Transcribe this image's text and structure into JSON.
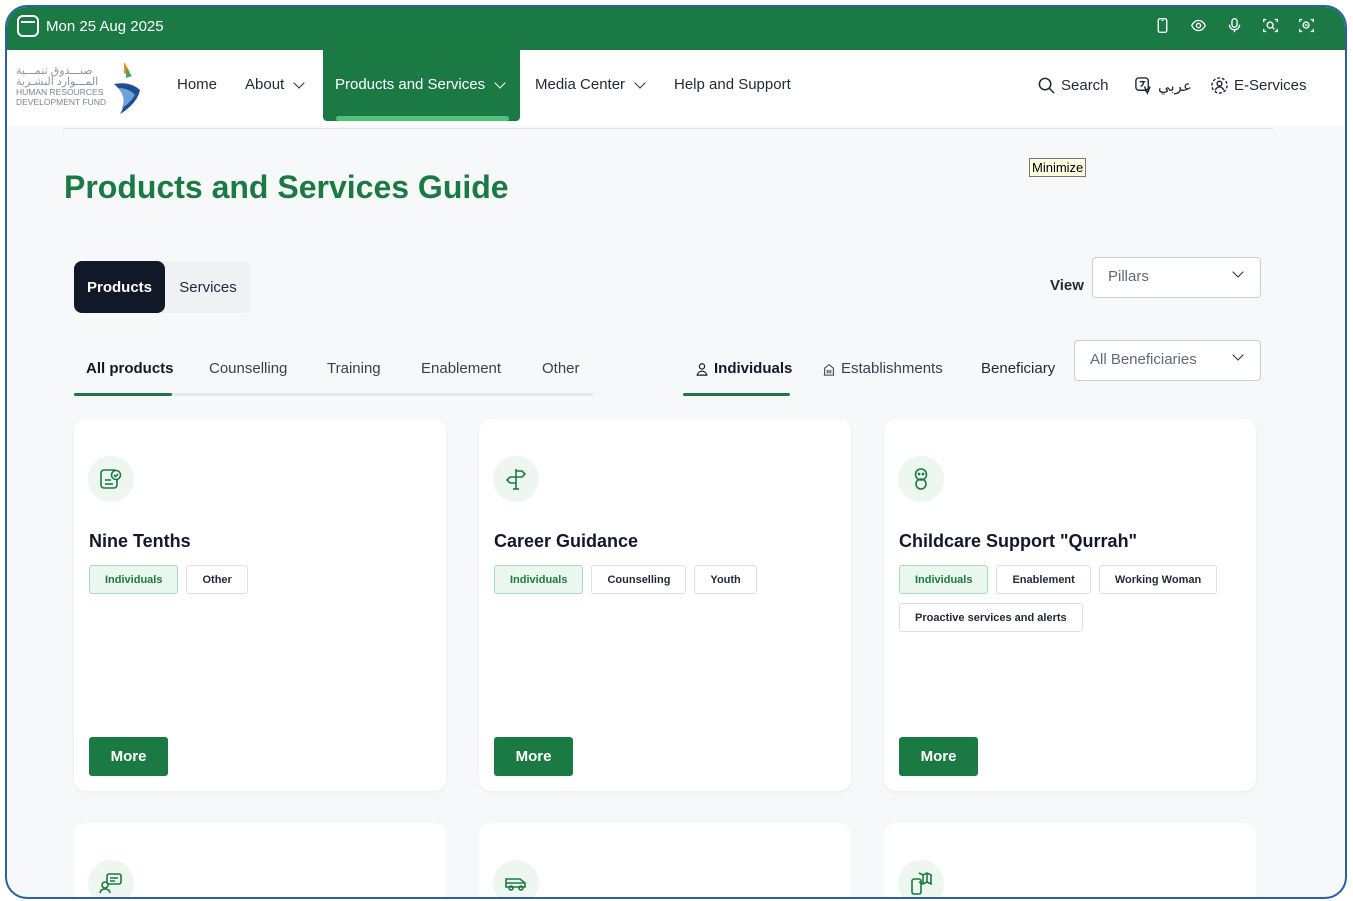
{
  "topbar": {
    "date": "Mon 25 Aug 2025",
    "icons": [
      "phone-icon",
      "eye-icon",
      "microphone-icon",
      "zoom-in-icon",
      "zoom-out-icon"
    ]
  },
  "logo": {
    "arabic_line1": "صنـــدوق تنمـــية",
    "arabic_line2": "المـــوارد البشـرية",
    "english_line1": "HUMAN RESOURCES",
    "english_line2": "DEVELOPMENT FUND"
  },
  "nav": {
    "home": "Home",
    "about": "About",
    "products": "Products and Services",
    "media": "Media Center",
    "help": "Help and Support",
    "search": "Search",
    "language": "عربي",
    "eservices": "E-Services"
  },
  "tooltip": "Minimize",
  "page_title": "Products and Services Guide",
  "segment": {
    "products": "Products",
    "services": "Services"
  },
  "view": {
    "label": "View",
    "selected": "Pillars"
  },
  "category_tabs": [
    "All products",
    "Counselling",
    "Training",
    "Enablement",
    "Other"
  ],
  "beneficiary_tabs": {
    "individuals": "Individuals",
    "establishments": "Establishments"
  },
  "beneficiary": {
    "label": "Beneficiary",
    "selected": "All Beneficiaries"
  },
  "cards": [
    {
      "title": "Nine Tenths",
      "tags": [
        "Individuals",
        "Other"
      ],
      "more": "More",
      "icon": "certificate-icon"
    },
    {
      "title": "Career Guidance",
      "tags": [
        "Individuals",
        "Counselling",
        "Youth"
      ],
      "more": "More",
      "icon": "signpost-icon"
    },
    {
      "title": "Childcare Support \"Qurrah\"",
      "tags": [
        "Individuals",
        "Enablement",
        "Working Woman",
        "Proactive services and alerts"
      ],
      "more": "More",
      "icon": "baby-icon"
    }
  ],
  "colors": {
    "brand_green": "#1b7a43",
    "accent_green": "#4fc27d",
    "dark": "#111827"
  }
}
